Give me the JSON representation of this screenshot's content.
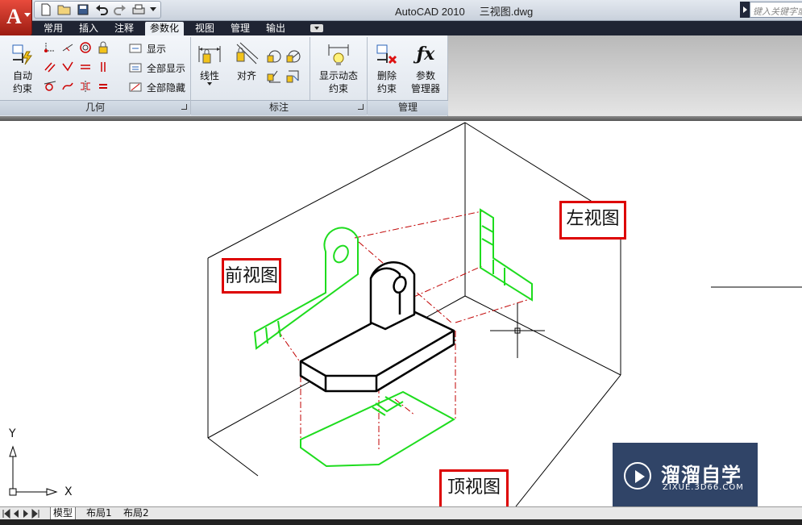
{
  "app": {
    "logo_letter": "A",
    "title": "AutoCAD 2010     三视图.dwg",
    "search_placeholder": "键入关键字或短语"
  },
  "quick_access": {
    "icons": [
      "new-icon",
      "open-icon",
      "save-icon",
      "undo-icon",
      "redo-icon",
      "plot-icon",
      "dropdown-icon"
    ]
  },
  "tabs": [
    {
      "label": "常用",
      "active": false
    },
    {
      "label": "插入",
      "active": false
    },
    {
      "label": "注释",
      "active": false
    },
    {
      "label": "参数化",
      "active": true
    },
    {
      "label": "视图",
      "active": false
    },
    {
      "label": "管理",
      "active": false
    },
    {
      "label": "输出",
      "active": false
    }
  ],
  "ribbon": {
    "geometry_panel": {
      "title": "几何",
      "auto_constrain": "自动\n约束",
      "show": "显示",
      "show_all": "全部显示",
      "hide_all": "全部隐藏"
    },
    "dimension_panel": {
      "title": "标注",
      "linear": "线性",
      "aligned": "对齐",
      "show_dynamic": "显示动态\n约束"
    },
    "manage_panel": {
      "title": "管理",
      "delete_constraints": "删除\n约束",
      "param_manager": "参数\n管理器"
    }
  },
  "drawing": {
    "labels": {
      "front": "前视图",
      "left": "左视图",
      "top": "顶视图"
    },
    "ucs": {
      "x": "X",
      "y": "Y"
    },
    "colors": {
      "projection": "#1edc1e",
      "object": "#000000",
      "hidden": "#c00000",
      "label_border": "#dd0000"
    }
  },
  "layout_tabs": [
    "模型",
    "布局1",
    "布局2"
  ],
  "watermark": {
    "name": "溜溜自学",
    "url": "ZIXUE.3D66.COM"
  }
}
